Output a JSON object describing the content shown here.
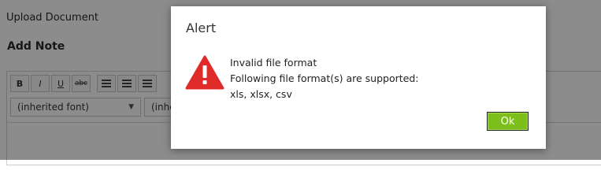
{
  "background": {
    "upload_title": "Upload Document",
    "add_note_title": "Add Note",
    "toolbar": {
      "buttons": [
        "B",
        "I",
        "U",
        "abc"
      ],
      "list_icons": [
        "bulleted-list-icon",
        "numbered-list-icon",
        "indent-icon"
      ]
    },
    "font_select": "(inherited font)",
    "size_select": "(inhe"
  },
  "alert": {
    "title": "Alert",
    "icon": "warning-icon",
    "message_line1": "Invalid file format",
    "message_line2": "Following file format(s) are supported:",
    "message_line3": "xls, xlsx, csv",
    "ok_label": "Ok"
  },
  "colors": {
    "warning_red": "#e02b2b",
    "ok_green": "#7cbf1a",
    "overlay": "rgba(0,0,0,0.45)"
  }
}
